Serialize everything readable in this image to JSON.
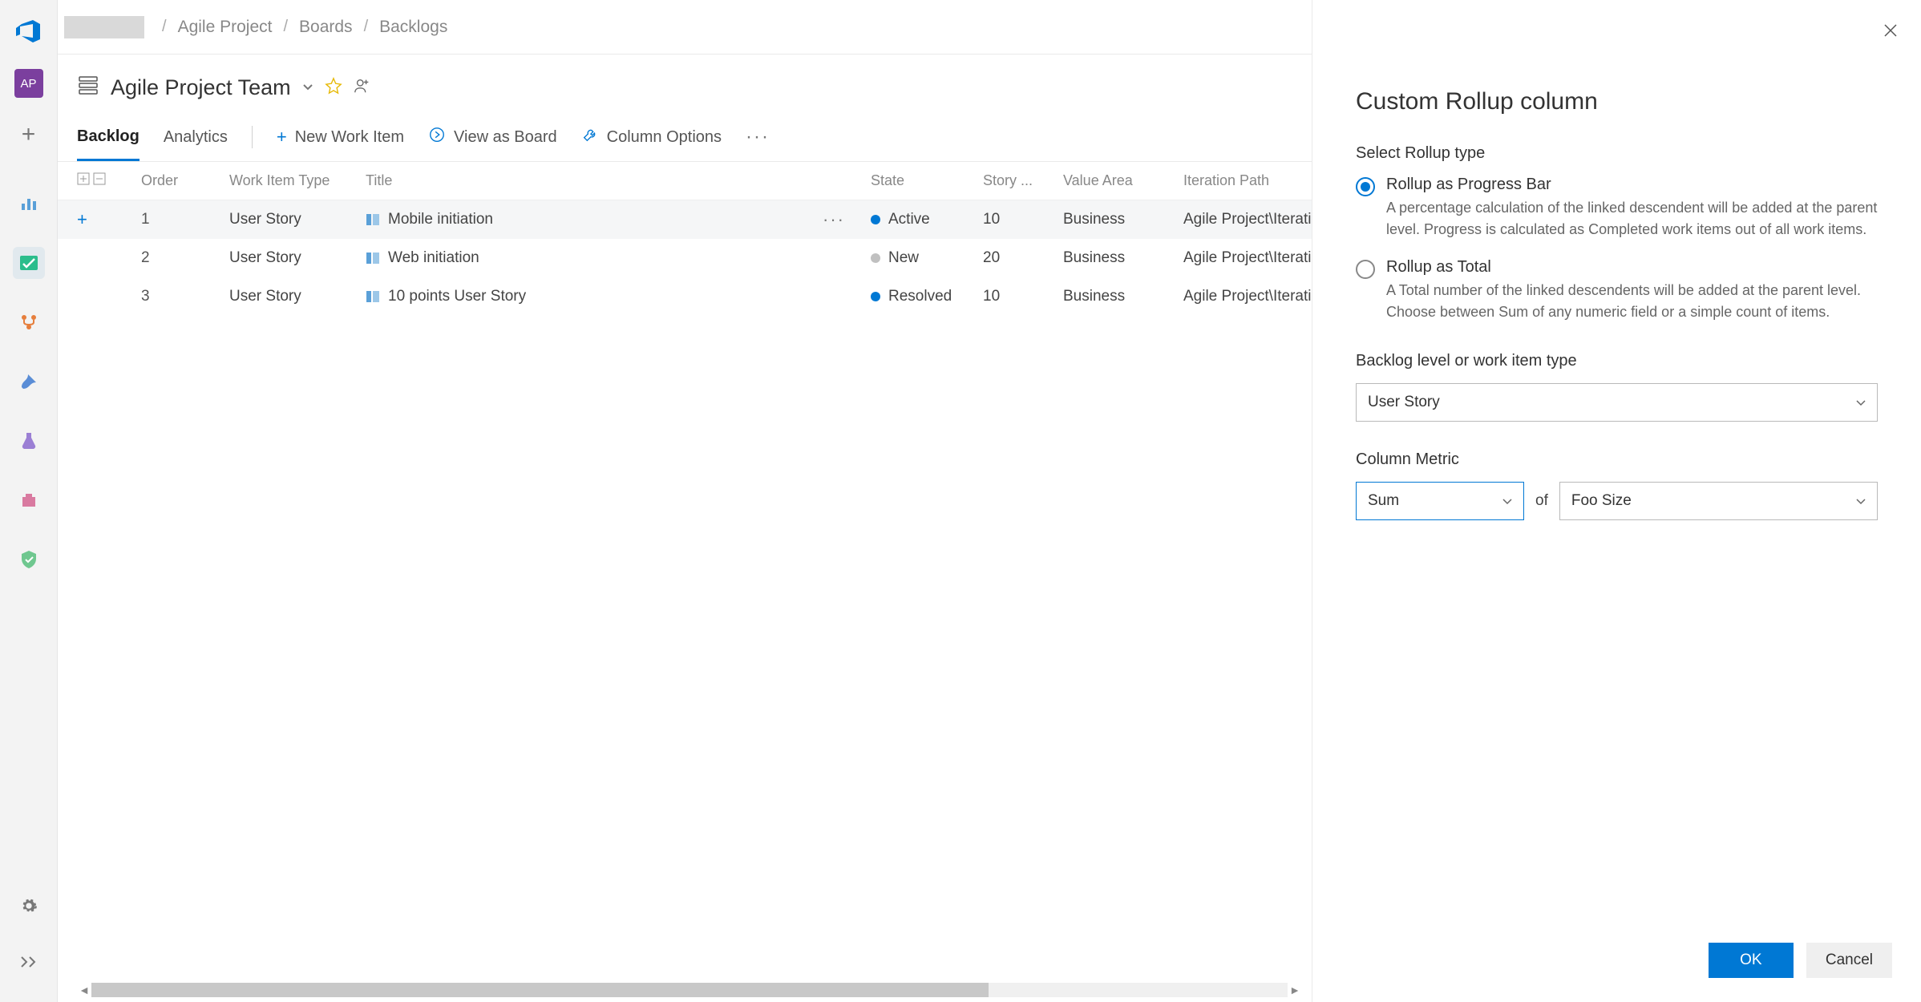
{
  "breadcrumbs": {
    "project": "Agile Project",
    "boards": "Boards",
    "backlogs": "Backlogs"
  },
  "leftbar": {
    "badge": "AP"
  },
  "header": {
    "team_name": "Agile Project Team"
  },
  "tabs": {
    "backlog": "Backlog",
    "analytics": "Analytics"
  },
  "actions": {
    "new_work_item": "New Work Item",
    "view_as_board": "View as Board",
    "column_options": "Column Options"
  },
  "columns": {
    "order": "Order",
    "work_item_type": "Work Item Type",
    "title": "Title",
    "state": "State",
    "story_points": "Story ...",
    "value_area": "Value Area",
    "iteration_path": "Iteration Path"
  },
  "rows": [
    {
      "order": "1",
      "type": "User Story",
      "title": "Mobile initiation",
      "state": "Active",
      "state_dot": "active",
      "story_points": "10",
      "value_area": "Business",
      "iteration_path": "Agile Project\\Iteration",
      "hover": true
    },
    {
      "order": "2",
      "type": "User Story",
      "title": "Web initiation",
      "state": "New",
      "state_dot": "new",
      "story_points": "20",
      "value_area": "Business",
      "iteration_path": "Agile Project\\Iteration",
      "hover": false
    },
    {
      "order": "3",
      "type": "User Story",
      "title": "10 points User Story",
      "state": "Resolved",
      "state_dot": "resolved",
      "story_points": "10",
      "value_area": "Business",
      "iteration_path": "Agile Project\\Iteration",
      "hover": false
    }
  ],
  "panel": {
    "title": "Custom Rollup column",
    "select_rollup_type": "Select Rollup type",
    "radio_progress": {
      "title": "Rollup as Progress Bar",
      "desc": "A percentage calculation of the linked descendent will be added at the parent level. Progress is calculated as Completed work items out of all work items."
    },
    "radio_total": {
      "title": "Rollup as Total",
      "desc": "A Total number of the linked descendents will be added at the parent level. Choose between Sum of any numeric field or a simple count of items."
    },
    "backlog_level_label": "Backlog level or work item type",
    "backlog_level_value": "User Story",
    "column_metric_label": "Column Metric",
    "metric_agg": "Sum",
    "metric_of": "of",
    "metric_field": "Foo Size",
    "ok": "OK",
    "cancel": "Cancel"
  }
}
